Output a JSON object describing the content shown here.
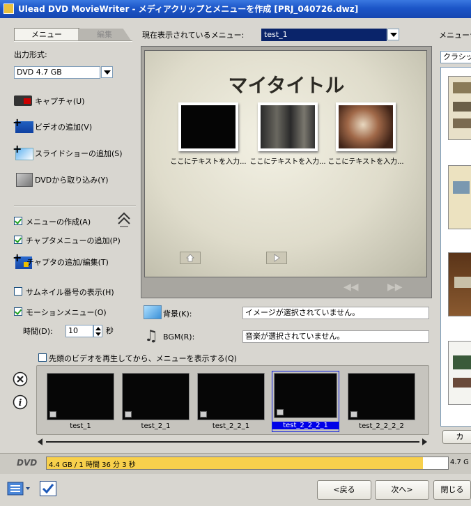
{
  "window": {
    "title": "Ulead DVD MovieWriter - メディアクリップとメニューを作成   [PRJ_040726.dwz]"
  },
  "tabs": [
    {
      "label": "メニュー"
    },
    {
      "label": "編集"
    }
  ],
  "output_format": {
    "label": "出力形式:",
    "value": "DVD 4.7 GB"
  },
  "actions": [
    {
      "label": "キャプチャ(U)",
      "icon": "capture-icon"
    },
    {
      "label": "ビデオの追加(V)",
      "icon": "add-video-icon"
    },
    {
      "label": "スライドショーの追加(S)",
      "icon": "add-slideshow-icon"
    },
    {
      "label": "DVDから取り込み(Y)",
      "icon": "import-dvd-icon"
    }
  ],
  "menu_options": {
    "create_menu": {
      "label": "メニューの作成(A)",
      "checked": true
    },
    "add_chapter_menu": {
      "label": "チャプタメニューの追加(P)",
      "checked": true
    },
    "add_edit_chapter": {
      "label": "チャプタの追加/編集(T)"
    },
    "show_thumb_number": {
      "label": "サムネイル番号の表示(H)",
      "checked": false
    },
    "motion_menu": {
      "label": "モーションメニュー(O)",
      "checked": true
    },
    "time": {
      "label": "時間(D):",
      "value": "10",
      "unit": "秒"
    }
  },
  "current_menu": {
    "label": "現在表示されているメニュー:",
    "value": "test_1"
  },
  "preview": {
    "title": "マイタイトル",
    "captions": [
      "ここにテキストを入力...",
      "ここにテキストを入力...",
      "ここにテキストを入力..."
    ]
  },
  "background": {
    "label": "背景(K):",
    "value": "イメージが選択されていません。"
  },
  "bgm": {
    "label": "BGM(R):",
    "value": "音楽が選択されていません。"
  },
  "play_first": {
    "label": "先頭のビデオを再生してから、メニューを表示する(Q)",
    "checked": false
  },
  "clips": [
    {
      "label": "test_1",
      "selected": false
    },
    {
      "label": "test_2_1",
      "selected": false
    },
    {
      "label": "test_2_2_1",
      "selected": false
    },
    {
      "label": "test_2_2_2_1",
      "selected": true
    },
    {
      "label": "test_2_2_2_2",
      "selected": false
    }
  ],
  "right_panel": {
    "label": "メニューテ",
    "dropdown": "クラシック",
    "button": "カ"
  },
  "status": {
    "disc_label": "DVD",
    "usage_text": "4.4 GB / 1 時間 36 分 3 秒",
    "capacity": "4.7 G",
    "fill_fraction": 0.938
  },
  "bottom": {
    "back": "<戻る",
    "next": "次へ>",
    "close": "閉じる"
  },
  "colors": {
    "title_bar": "#1c55c8",
    "selection": "#0000e8",
    "usage_bar": "#f8d04c"
  }
}
